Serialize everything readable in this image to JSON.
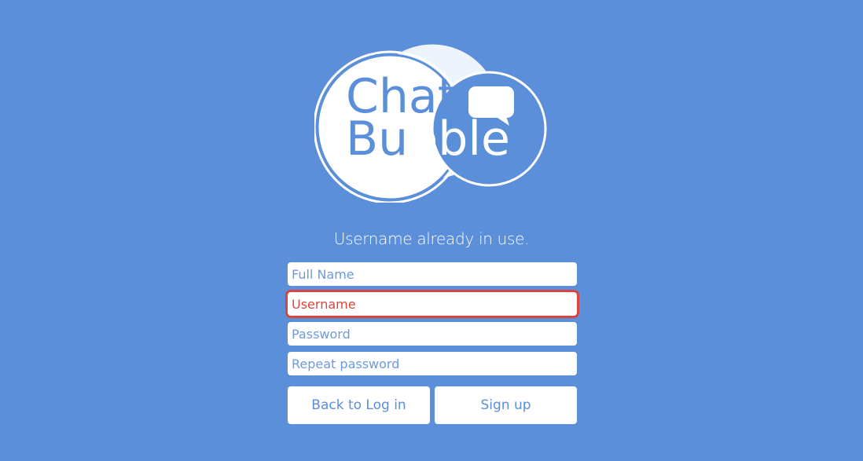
{
  "logo": {
    "line1": "Chat",
    "line2_left": "Bu",
    "line2_right": "bble",
    "icon": "speech-bubble-icon"
  },
  "message": "Username already in use.",
  "form": {
    "full_name_placeholder": "Full Name",
    "username_placeholder": "Username",
    "password_placeholder": "Password",
    "repeat_password_placeholder": "Repeat password"
  },
  "buttons": {
    "back_label": "Back to Log in",
    "signup_label": "Sign up"
  },
  "colors": {
    "background": "#5b8fd9",
    "error": "#d9443f",
    "white": "#ffffff"
  }
}
